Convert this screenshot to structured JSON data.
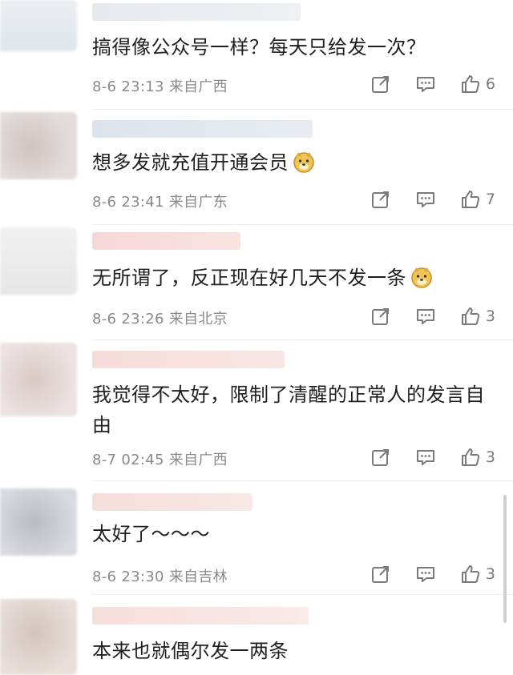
{
  "comments": [
    {
      "text": "搞得像公众号一样？每天只给发一次？",
      "meta": "8-6 23:13 来自广西",
      "likes": "6",
      "emoji": ""
    },
    {
      "text": "想多发就充值开通会员",
      "meta": "8-6 23:41 来自广东",
      "likes": "7",
      "emoji": "doge-emoji"
    },
    {
      "text": "无所谓了，反正现在好几天不发一条",
      "meta": "8-6 23:26 来自北京",
      "likes": "3",
      "emoji": "doge-emoji"
    },
    {
      "text": "我觉得不太好，限制了清醒的正常人的发言自由",
      "meta": "8-7 02:45 来自广西",
      "likes": "3",
      "emoji": ""
    },
    {
      "text": "太好了～～～",
      "meta": "8-6 23:30 来自吉林",
      "likes": "3",
      "emoji": ""
    },
    {
      "text": "本来也就偶尔发一两条",
      "meta": "",
      "likes": "",
      "emoji": ""
    }
  ],
  "icons": {
    "share": "share-icon",
    "reply": "comment-icon",
    "like": "thumbs-up-icon"
  },
  "colors": {
    "meta_text": "#8a8a8a",
    "icon": "#7a7a7a",
    "divider": "#ececec"
  }
}
